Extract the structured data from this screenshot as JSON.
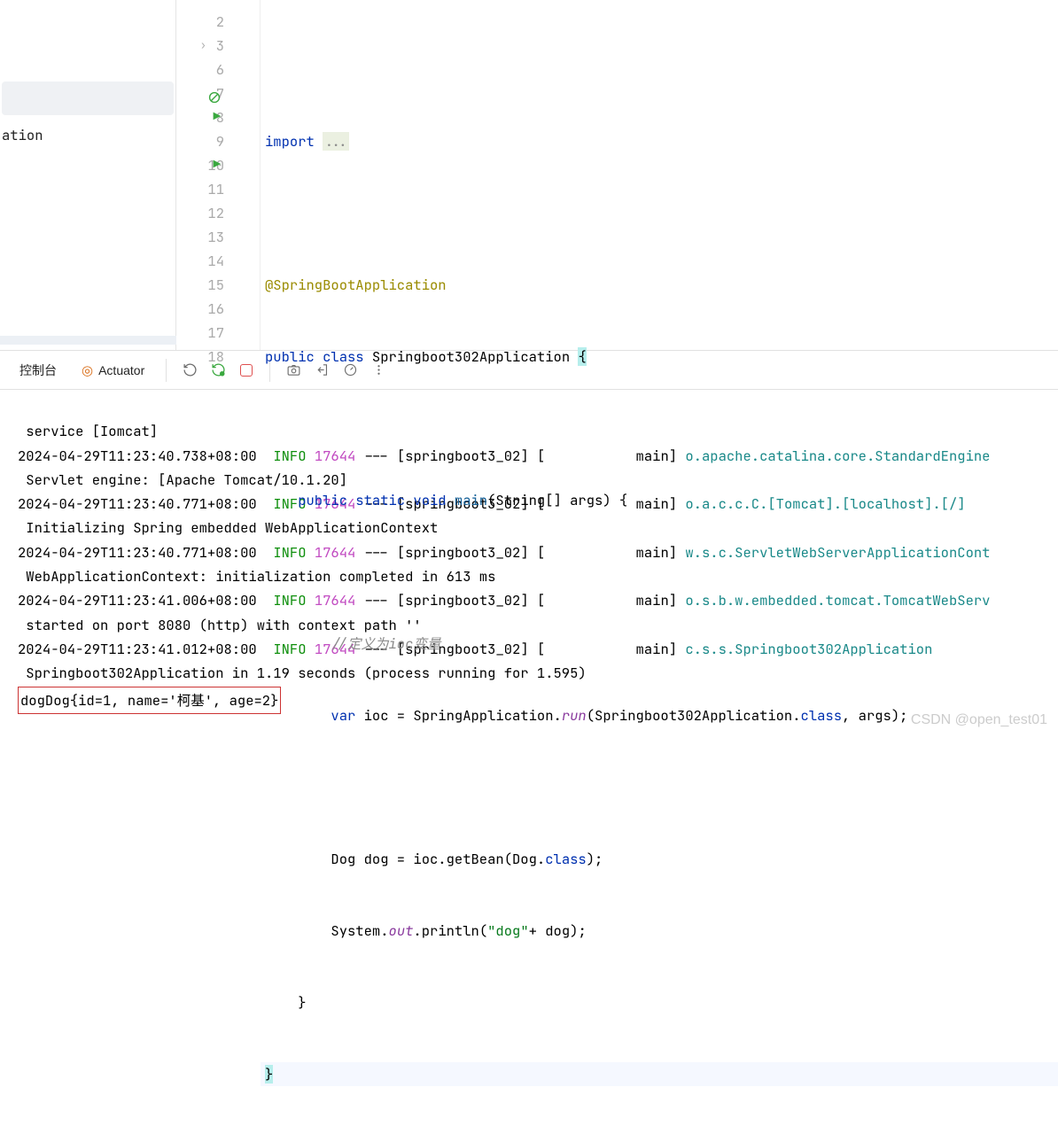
{
  "sidebar": {
    "entry": "ation"
  },
  "editor": {
    "lines": [
      {
        "num": "2"
      },
      {
        "num": "3",
        "import_kw": "import ",
        "dots": "..."
      },
      {
        "num": "6"
      },
      {
        "num": "7",
        "ann": "@SpringBootApplication"
      },
      {
        "num": "8",
        "kw_public": "public ",
        "kw_class": "class ",
        "cls": "Springboot302Application ",
        "brace": "{"
      },
      {
        "num": "9"
      },
      {
        "num": "10",
        "indent": "    ",
        "kw1": "public static void ",
        "fn": "main",
        "args": "(String[] args) {"
      },
      {
        "num": "11"
      },
      {
        "num": "12",
        "indent": "        ",
        "cmt": "//定义为ioc变量"
      },
      {
        "num": "13",
        "indent": "        ",
        "kw": "var ",
        "t1": "ioc = SpringApplication.",
        "stat": "run",
        "t2": "(Springboot302Application.",
        "cls": "class",
        "t3": ", args);"
      },
      {
        "num": "14"
      },
      {
        "num": "15",
        "indent": "        ",
        "t1": "Dog dog = ioc.getBean(Dog.",
        "cls": "class",
        "t2": ");"
      },
      {
        "num": "16",
        "indent": "        ",
        "t1": "System.",
        "stat": "out",
        "t2": ".println(",
        "str": "\"dog\"",
        "t3": "+ dog);"
      },
      {
        "num": "17",
        "indent": "    ",
        "brace": "}"
      },
      {
        "num": "18",
        "brace": "}"
      }
    ]
  },
  "console": {
    "tab1": "控制台",
    "tab2": "Actuator",
    "lines": [
      {
        "raw": " service [Iomcat]"
      },
      {
        "ts": "2024-04-29T11:23:40.738+08:00",
        "lvl": "INFO",
        "pid": "17644",
        "sep": " --- ",
        "thr": "[springboot3_02] [           main] ",
        "logger": "o.apache.catalina.core.StandardEngine"
      },
      {
        "raw": " Servlet engine: [Apache Tomcat/10.1.20]"
      },
      {
        "ts": "2024-04-29T11:23:40.771+08:00",
        "lvl": "INFO",
        "pid": "17644",
        "sep": " --- ",
        "thr": "[springboot3_02] [           main] ",
        "logger": "o.a.c.c.C.[Tomcat].[localhost].[/]"
      },
      {
        "raw": " Initializing Spring embedded WebApplicationContext"
      },
      {
        "ts": "2024-04-29T11:23:40.771+08:00",
        "lvl": "INFO",
        "pid": "17644",
        "sep": " --- ",
        "thr": "[springboot3_02] [           main] ",
        "logger": "w.s.c.ServletWebServerApplicationCont"
      },
      {
        "raw": " WebApplicationContext: initialization completed in 613 ms"
      },
      {
        "ts": "2024-04-29T11:23:41.006+08:00",
        "lvl": "INFO",
        "pid": "17644",
        "sep": " --- ",
        "thr": "[springboot3_02] [           main] ",
        "logger": "o.s.b.w.embedded.tomcat.TomcatWebServ"
      },
      {
        "raw": " started on port 8080 (http) with context path ''"
      },
      {
        "ts": "2024-04-29T11:23:41.012+08:00",
        "lvl": "INFO",
        "pid": "17644",
        "sep": " --- ",
        "thr": "[springboot3_02] [           main] ",
        "logger": "c.s.s.Springboot302Application"
      },
      {
        "raw": " Springboot302Application in 1.19 seconds (process running for 1.595)"
      },
      {
        "boxed": "dogDog{id=1, name='柯基', age=2}"
      }
    ]
  },
  "watermark": "CSDN @open_test01"
}
